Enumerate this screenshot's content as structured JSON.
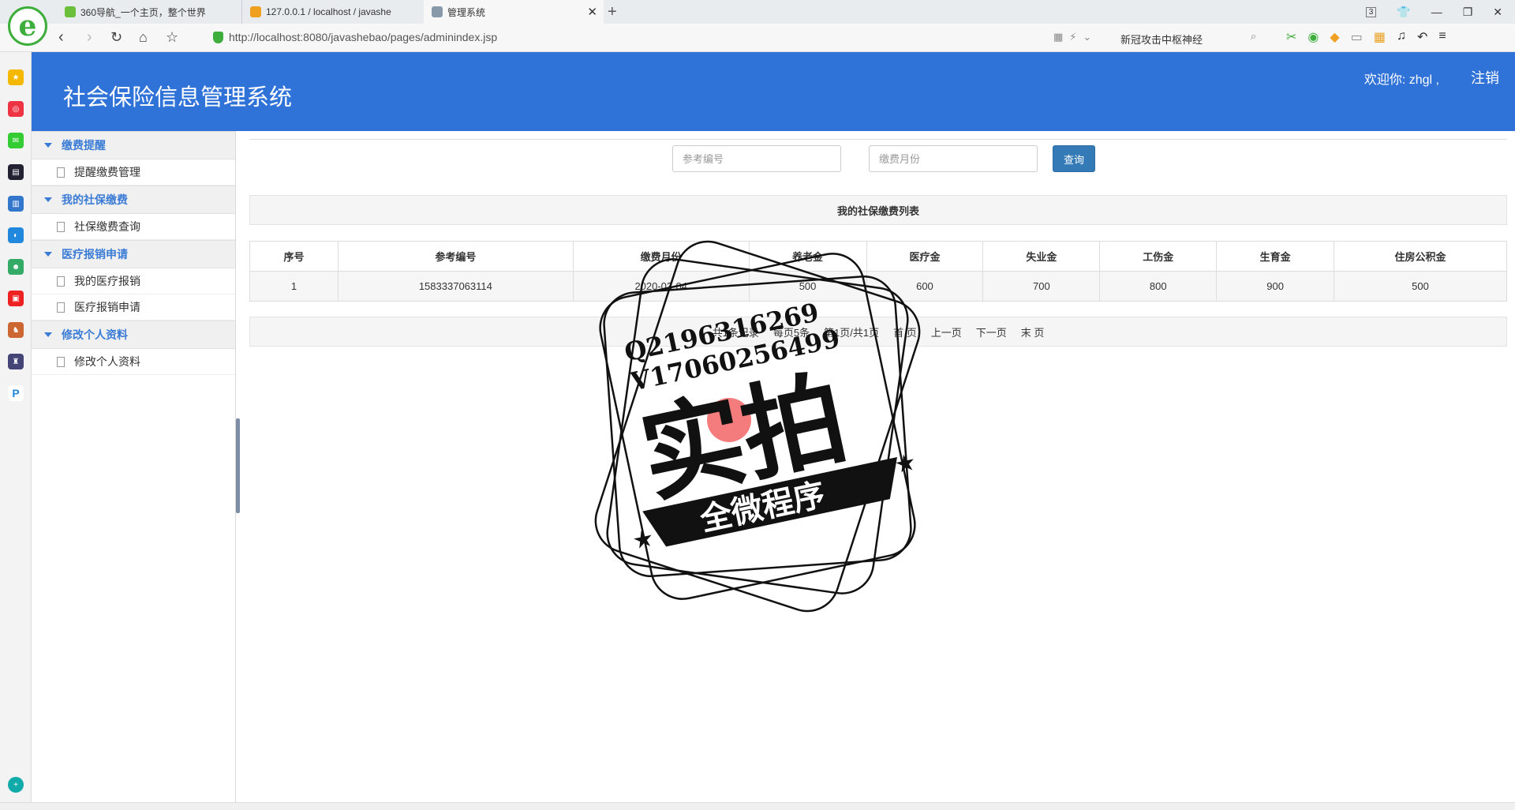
{
  "browser": {
    "tabs": [
      {
        "title": "360导航_一个主页，整个世界",
        "color": "#6bbf3a"
      },
      {
        "title": "127.0.0.1 / localhost / javashe",
        "color": "#f0a020"
      },
      {
        "title": "管理系统",
        "color": "#8899aa"
      }
    ],
    "tab_count": "3",
    "url": "http://localhost:8080/javashebao/pages/adminindex.jsp",
    "search_text": "新冠攻击中枢神经"
  },
  "app": {
    "title": "社会保险信息管理系统",
    "welcome": "欢迎你: zhgl ,",
    "logout": "注销",
    "colors": {
      "header": "#2f73d9",
      "menu_head": "#3a7bd5",
      "button": "#337ab7"
    }
  },
  "menu": {
    "groups": [
      {
        "label": "缴费提醒",
        "items": [
          "提醒缴费管理"
        ]
      },
      {
        "label": "我的社保缴费",
        "items": [
          "社保缴费查询"
        ]
      },
      {
        "label": "医疗报销申请",
        "items": [
          "我的医疗报销",
          "医疗报销申请"
        ]
      },
      {
        "label": "修改个人资料",
        "items": [
          "修改个人资料"
        ]
      }
    ]
  },
  "search": {
    "ref_placeholder": "参考编号",
    "month_placeholder": "缴费月份",
    "query_label": "查询"
  },
  "table": {
    "title": "我的社保缴费列表",
    "headers": [
      "序号",
      "参考编号",
      "缴费月份",
      "养老金",
      "医疗金",
      "失业金",
      "工伤金",
      "生育金",
      "住房公积金"
    ],
    "rows": [
      [
        "1",
        "1583337063114",
        "2020-03-04",
        "500",
        "600",
        "700",
        "800",
        "900",
        "500"
      ]
    ]
  },
  "pager": {
    "summary": "共1条记录",
    "per_page": "每页5条",
    "page_info": "第1页/共1页",
    "first": "首 页",
    "prev": "上一页",
    "next": "下一页",
    "last": "末 页"
  },
  "watermark": {
    "line1": "Q2196316269",
    "line2": "V17060256499",
    "big": "实拍",
    "ribbon": "全微程序"
  }
}
